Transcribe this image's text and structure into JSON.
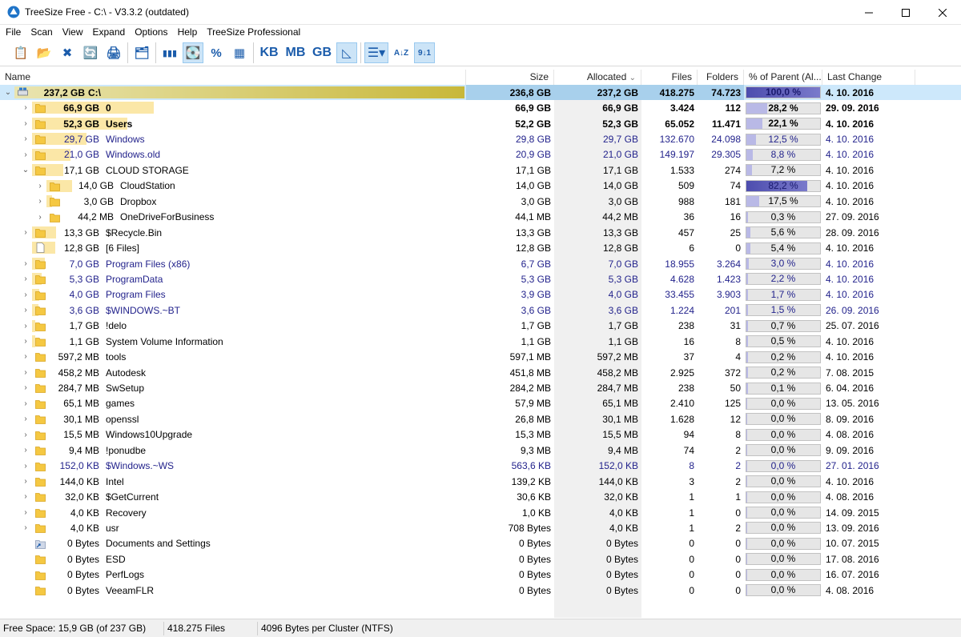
{
  "window": {
    "title": "TreeSize Free - C:\\ - V3.3.2 (outdated)"
  },
  "menu": [
    "File",
    "Scan",
    "View",
    "Expand",
    "Options",
    "Help",
    "TreeSize Professional"
  ],
  "toolbar": {
    "items": [
      {
        "name": "report-icon",
        "glyph": "📋",
        "active": false
      },
      {
        "name": "select-directory-icon",
        "glyph": "📂",
        "active": false
      },
      {
        "name": "close-icon",
        "glyph": "✖",
        "active": false
      },
      {
        "name": "refresh-icon",
        "glyph": "🔄",
        "active": false
      },
      {
        "name": "print-icon",
        "glyph": "🖨",
        "active": false
      },
      {
        "name": "sep1",
        "sep": true
      },
      {
        "name": "explorer-icon",
        "glyph": "🗂",
        "active": false
      },
      {
        "name": "sep2",
        "sep": true
      },
      {
        "name": "bars-icon",
        "glyph": "▮▮▮",
        "active": false
      },
      {
        "name": "drive-icon",
        "glyph": "💽",
        "active": true
      },
      {
        "name": "percent-icon",
        "glyph": "%",
        "active": false
      },
      {
        "name": "file-count-icon",
        "glyph": "▦",
        "active": false
      },
      {
        "name": "sep3",
        "sep": true
      },
      {
        "name": "kb-unit",
        "glyph": "KB",
        "active": false,
        "wide": true
      },
      {
        "name": "mb-unit",
        "glyph": "MB",
        "active": false,
        "wide": true
      },
      {
        "name": "gb-unit",
        "glyph": "GB",
        "active": false,
        "wide": true
      },
      {
        "name": "auto-unit-icon",
        "glyph": "◺",
        "active": true
      },
      {
        "name": "sep4",
        "sep": true
      },
      {
        "name": "details-view-icon",
        "glyph": "☰▾",
        "active": true,
        "wide": true
      },
      {
        "name": "sort-alpha-icon",
        "glyph": "A↓Z",
        "active": false
      },
      {
        "name": "sort-size-icon",
        "glyph": "9↓1",
        "active": true
      }
    ]
  },
  "columns": {
    "name": "Name",
    "size": "Size",
    "allocated": "Allocated",
    "allocated_sort": "⌄",
    "files": "Files",
    "folders": "Folders",
    "pct": "% of Parent (Al...",
    "date": "Last Change"
  },
  "rows": [
    {
      "level": 0,
      "exp": "⌄",
      "icon": "drive",
      "sz": "237,2 GB",
      "name": "C:\\",
      "size": "236,8 GB",
      "alloc": "237,2 GB",
      "files": "418.275",
      "folders": "74.723",
      "pct": "100,0 %",
      "pctv": 100,
      "date": "4. 10. 2016",
      "bar": 1.0,
      "bold": true,
      "blue": false,
      "sel": true
    },
    {
      "level": 1,
      "exp": "›",
      "icon": "folder",
      "sz": "66,9 GB",
      "name": "0",
      "size": "66,9 GB",
      "alloc": "66,9 GB",
      "files": "3.424",
      "folders": "112",
      "pct": "28,2 %",
      "pctv": 28.2,
      "date": "29. 09. 2016",
      "bar": 0.282,
      "bold": true,
      "blue": false
    },
    {
      "level": 1,
      "exp": "›",
      "icon": "folder",
      "sz": "52,3 GB",
      "name": "Users",
      "size": "52,2 GB",
      "alloc": "52,3 GB",
      "files": "65.052",
      "folders": "11.471",
      "pct": "22,1 %",
      "pctv": 22.1,
      "date": "4. 10. 2016",
      "bar": 0.221,
      "bold": true,
      "blue": false
    },
    {
      "level": 1,
      "exp": "›",
      "icon": "folder",
      "sz": "29,7 GB",
      "name": "Windows",
      "size": "29,8 GB",
      "alloc": "29,7 GB",
      "files": "132.670",
      "folders": "24.098",
      "pct": "12,5 %",
      "pctv": 12.5,
      "date": "4. 10. 2016",
      "bar": 0.125,
      "bold": false,
      "blue": true
    },
    {
      "level": 1,
      "exp": "›",
      "icon": "folder",
      "sz": "21,0 GB",
      "name": "Windows.old",
      "size": "20,9 GB",
      "alloc": "21,0 GB",
      "files": "149.197",
      "folders": "29.305",
      "pct": "8,8 %",
      "pctv": 8.8,
      "date": "4. 10. 2016",
      "bar": 0.088,
      "bold": false,
      "blue": true
    },
    {
      "level": 1,
      "exp": "⌄",
      "icon": "folder",
      "sz": "17,1 GB",
      "name": "CLOUD STORAGE",
      "size": "17,1 GB",
      "alloc": "17,1 GB",
      "files": "1.533",
      "folders": "274",
      "pct": "7,2 %",
      "pctv": 7.2,
      "date": "4. 10. 2016",
      "bar": 0.072,
      "bold": false,
      "blue": false
    },
    {
      "level": 2,
      "exp": "›",
      "icon": "folder",
      "sz": "14,0 GB",
      "name": "CloudStation",
      "size": "14,0 GB",
      "alloc": "14,0 GB",
      "files": "509",
      "folders": "74",
      "pct": "82,2 %",
      "pctv": 82.2,
      "date": "4. 10. 2016",
      "bar": 0.059,
      "bold": false,
      "blue": false
    },
    {
      "level": 2,
      "exp": "›",
      "icon": "folder",
      "sz": "3,0 GB",
      "name": "Dropbox",
      "size": "3,0 GB",
      "alloc": "3,0 GB",
      "files": "988",
      "folders": "181",
      "pct": "17,5 %",
      "pctv": 17.5,
      "date": "4. 10. 2016",
      "bar": 0.013,
      "bold": false,
      "blue": false
    },
    {
      "level": 2,
      "exp": "›",
      "icon": "folder",
      "sz": "44,2 MB",
      "name": "OneDriveForBusiness",
      "size": "44,1 MB",
      "alloc": "44,2 MB",
      "files": "36",
      "folders": "16",
      "pct": "0,3 %",
      "pctv": 0.3,
      "date": "27. 09. 2016",
      "bar": 0.0,
      "bold": false,
      "blue": false
    },
    {
      "level": 1,
      "exp": "›",
      "icon": "folder",
      "sz": "13,3 GB",
      "name": "$Recycle.Bin",
      "size": "13,3 GB",
      "alloc": "13,3 GB",
      "files": "457",
      "folders": "25",
      "pct": "5,6 %",
      "pctv": 5.6,
      "date": "28. 09. 2016",
      "bar": 0.056,
      "bold": false,
      "blue": false
    },
    {
      "level": 1,
      "exp": "",
      "icon": "file",
      "sz": "12,8 GB",
      "name": "[6 Files]",
      "size": "12,8 GB",
      "alloc": "12,8 GB",
      "files": "6",
      "folders": "0",
      "pct": "5,4 %",
      "pctv": 5.4,
      "date": "4. 10. 2016",
      "bar": 0.054,
      "bold": false,
      "blue": false
    },
    {
      "level": 1,
      "exp": "›",
      "icon": "folder",
      "sz": "7,0 GB",
      "name": "Program Files (x86)",
      "size": "6,7 GB",
      "alloc": "7,0 GB",
      "files": "18.955",
      "folders": "3.264",
      "pct": "3,0 %",
      "pctv": 3.0,
      "date": "4. 10. 2016",
      "bar": 0.03,
      "bold": false,
      "blue": true
    },
    {
      "level": 1,
      "exp": "›",
      "icon": "folder",
      "sz": "5,3 GB",
      "name": "ProgramData",
      "size": "5,3 GB",
      "alloc": "5,3 GB",
      "files": "4.628",
      "folders": "1.423",
      "pct": "2,2 %",
      "pctv": 2.2,
      "date": "4. 10. 2016",
      "bar": 0.022,
      "bold": false,
      "blue": true
    },
    {
      "level": 1,
      "exp": "›",
      "icon": "folder",
      "sz": "4,0 GB",
      "name": "Program Files",
      "size": "3,9 GB",
      "alloc": "4,0 GB",
      "files": "33.455",
      "folders": "3.903",
      "pct": "1,7 %",
      "pctv": 1.7,
      "date": "4. 10. 2016",
      "bar": 0.017,
      "bold": false,
      "blue": true
    },
    {
      "level": 1,
      "exp": "›",
      "icon": "folder",
      "sz": "3,6 GB",
      "name": "$WINDOWS.~BT",
      "size": "3,6 GB",
      "alloc": "3,6 GB",
      "files": "1.224",
      "folders": "201",
      "pct": "1,5 %",
      "pctv": 1.5,
      "date": "26. 09. 2016",
      "bar": 0.015,
      "bold": false,
      "blue": true
    },
    {
      "level": 1,
      "exp": "›",
      "icon": "folder",
      "sz": "1,7 GB",
      "name": "!delo",
      "size": "1,7 GB",
      "alloc": "1,7 GB",
      "files": "238",
      "folders": "31",
      "pct": "0,7 %",
      "pctv": 0.7,
      "date": "25. 07. 2016",
      "bar": 0.007,
      "bold": false,
      "blue": false
    },
    {
      "level": 1,
      "exp": "›",
      "icon": "folder",
      "sz": "1,1 GB",
      "name": "System Volume Information",
      "size": "1,1 GB",
      "alloc": "1,1 GB",
      "files": "16",
      "folders": "8",
      "pct": "0,5 %",
      "pctv": 0.5,
      "date": "4. 10. 2016",
      "bar": 0.005,
      "bold": false,
      "blue": false
    },
    {
      "level": 1,
      "exp": "›",
      "icon": "folder",
      "sz": "597,2 MB",
      "name": "tools",
      "size": "597,1 MB",
      "alloc": "597,2 MB",
      "files": "37",
      "folders": "4",
      "pct": "0,2 %",
      "pctv": 0.2,
      "date": "4. 10. 2016",
      "bar": 0.0,
      "bold": false,
      "blue": false
    },
    {
      "level": 1,
      "exp": "›",
      "icon": "folder",
      "sz": "458,2 MB",
      "name": "Autodesk",
      "size": "451,8 MB",
      "alloc": "458,2 MB",
      "files": "2.925",
      "folders": "372",
      "pct": "0,2 %",
      "pctv": 0.2,
      "date": "7. 08. 2015",
      "bar": 0.0,
      "bold": false,
      "blue": false
    },
    {
      "level": 1,
      "exp": "›",
      "icon": "folder",
      "sz": "284,7 MB",
      "name": "SwSetup",
      "size": "284,2 MB",
      "alloc": "284,7 MB",
      "files": "238",
      "folders": "50",
      "pct": "0,1 %",
      "pctv": 0.1,
      "date": "6. 04. 2016",
      "bar": 0.0,
      "bold": false,
      "blue": false
    },
    {
      "level": 1,
      "exp": "›",
      "icon": "folder",
      "sz": "65,1 MB",
      "name": "games",
      "size": "57,9 MB",
      "alloc": "65,1 MB",
      "files": "2.410",
      "folders": "125",
      "pct": "0,0 %",
      "pctv": 0.0,
      "date": "13. 05. 2016",
      "bar": 0.0,
      "bold": false,
      "blue": false
    },
    {
      "level": 1,
      "exp": "›",
      "icon": "folder",
      "sz": "30,1 MB",
      "name": "openssl",
      "size": "26,8 MB",
      "alloc": "30,1 MB",
      "files": "1.628",
      "folders": "12",
      "pct": "0,0 %",
      "pctv": 0.0,
      "date": "8. 09. 2016",
      "bar": 0.0,
      "bold": false,
      "blue": false
    },
    {
      "level": 1,
      "exp": "›",
      "icon": "folder",
      "sz": "15,5 MB",
      "name": "Windows10Upgrade",
      "size": "15,3 MB",
      "alloc": "15,5 MB",
      "files": "94",
      "folders": "8",
      "pct": "0,0 %",
      "pctv": 0.0,
      "date": "4. 08. 2016",
      "bar": 0.0,
      "bold": false,
      "blue": false
    },
    {
      "level": 1,
      "exp": "›",
      "icon": "folder",
      "sz": "9,4 MB",
      "name": "!ponudbe",
      "size": "9,3 MB",
      "alloc": "9,4 MB",
      "files": "74",
      "folders": "2",
      "pct": "0,0 %",
      "pctv": 0.0,
      "date": "9. 09. 2016",
      "bar": 0.0,
      "bold": false,
      "blue": false
    },
    {
      "level": 1,
      "exp": "›",
      "icon": "folder",
      "sz": "152,0 KB",
      "name": "$Windows.~WS",
      "size": "563,6 KB",
      "alloc": "152,0 KB",
      "files": "8",
      "folders": "2",
      "pct": "0,0 %",
      "pctv": 0.0,
      "date": "27. 01. 2016",
      "bar": 0.0,
      "bold": false,
      "blue": true
    },
    {
      "level": 1,
      "exp": "›",
      "icon": "folder",
      "sz": "144,0 KB",
      "name": "Intel",
      "size": "139,2 KB",
      "alloc": "144,0 KB",
      "files": "3",
      "folders": "2",
      "pct": "0,0 %",
      "pctv": 0.0,
      "date": "4. 10. 2016",
      "bar": 0.0,
      "bold": false,
      "blue": false
    },
    {
      "level": 1,
      "exp": "›",
      "icon": "folder",
      "sz": "32,0 KB",
      "name": "$GetCurrent",
      "size": "30,6 KB",
      "alloc": "32,0 KB",
      "files": "1",
      "folders": "1",
      "pct": "0,0 %",
      "pctv": 0.0,
      "date": "4. 08. 2016",
      "bar": 0.0,
      "bold": false,
      "blue": false
    },
    {
      "level": 1,
      "exp": "›",
      "icon": "folder",
      "sz": "4,0 KB",
      "name": "Recovery",
      "size": "1,0 KB",
      "alloc": "4,0 KB",
      "files": "1",
      "folders": "0",
      "pct": "0,0 %",
      "pctv": 0.0,
      "date": "14. 09. 2015",
      "bar": 0.0,
      "bold": false,
      "blue": false
    },
    {
      "level": 1,
      "exp": "›",
      "icon": "folder",
      "sz": "4,0 KB",
      "name": "usr",
      "size": "708 Bytes",
      "alloc": "4,0 KB",
      "files": "1",
      "folders": "2",
      "pct": "0,0 %",
      "pctv": 0.0,
      "date": "13. 09. 2016",
      "bar": 0.0,
      "bold": false,
      "blue": false
    },
    {
      "level": 1,
      "exp": "",
      "icon": "link",
      "sz": "0 Bytes",
      "name": "Documents and Settings",
      "size": "0 Bytes",
      "alloc": "0 Bytes",
      "files": "0",
      "folders": "0",
      "pct": "0,0 %",
      "pctv": 0.0,
      "date": "10. 07. 2015",
      "bar": 0.0,
      "bold": false,
      "blue": false
    },
    {
      "level": 1,
      "exp": "",
      "icon": "folder",
      "sz": "0 Bytes",
      "name": "ESD",
      "size": "0 Bytes",
      "alloc": "0 Bytes",
      "files": "0",
      "folders": "0",
      "pct": "0,0 %",
      "pctv": 0.0,
      "date": "17. 08. 2016",
      "bar": 0.0,
      "bold": false,
      "blue": false
    },
    {
      "level": 1,
      "exp": "",
      "icon": "folder",
      "sz": "0 Bytes",
      "name": "PerfLogs",
      "size": "0 Bytes",
      "alloc": "0 Bytes",
      "files": "0",
      "folders": "0",
      "pct": "0,0 %",
      "pctv": 0.0,
      "date": "16. 07. 2016",
      "bar": 0.0,
      "bold": false,
      "blue": false
    },
    {
      "level": 1,
      "exp": "",
      "icon": "folder",
      "sz": "0 Bytes",
      "name": "VeeamFLR",
      "size": "0 Bytes",
      "alloc": "0 Bytes",
      "files": "0",
      "folders": "0",
      "pct": "0,0 %",
      "pctv": 0.0,
      "date": "4. 08. 2016",
      "bar": 0.0,
      "bold": false,
      "blue": false
    }
  ],
  "status": {
    "free_space": "Free Space: 15,9 GB  (of 237 GB)",
    "files": "418.275  Files",
    "cluster": "4096 Bytes per Cluster (NTFS)"
  },
  "colors": {
    "selection": "#cde8fb",
    "size_bar": "#f9dc86",
    "pct_fill": "#b9b9e6",
    "link_blue": "#23238c"
  }
}
